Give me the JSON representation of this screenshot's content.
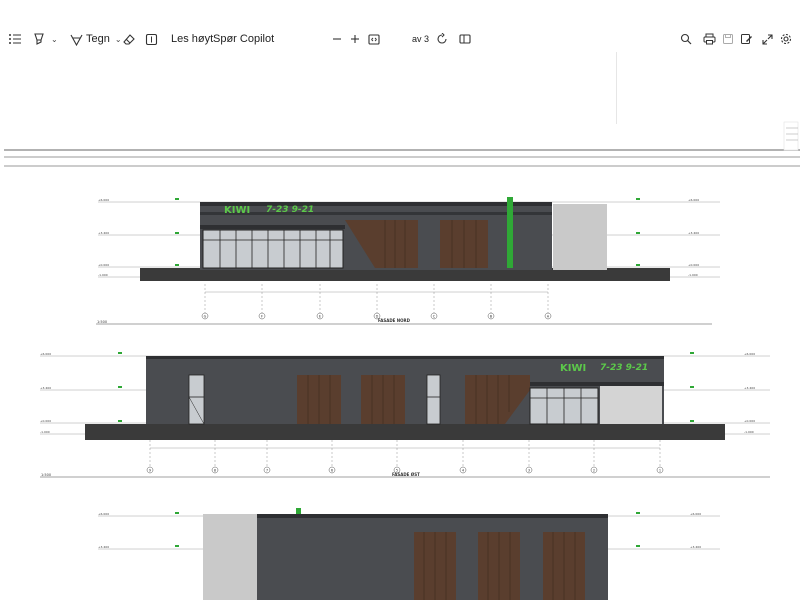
{
  "toolbar": {
    "draw_label": "Tegn",
    "read_aloud_label": "Les høyt",
    "copilot_label": "Spør Copilot",
    "page_of": "av 3",
    "icons": [
      "contents-icon",
      "highlight-icon",
      "draw-icon",
      "eraser-icon",
      "text-box-icon",
      "zoom-out-icon",
      "zoom-in-icon",
      "fit-page-icon",
      "rotate-icon",
      "page-view-icon",
      "search-icon",
      "print-icon",
      "save-icon",
      "save-as-icon",
      "fullscreen-icon",
      "settings-icon"
    ]
  },
  "drawing": {
    "facade1_title": "FASADE NORD",
    "facade2_title": "FASADE ØST",
    "scale": "1:500",
    "sign_logo": "KIWI",
    "sign_hours": "7-23 9-21",
    "grid_nord": [
      "G",
      "F",
      "E",
      "D",
      "C",
      "B",
      "A"
    ],
    "grid_ost": [
      "9",
      "8",
      "7",
      "6",
      "5",
      "4",
      "3",
      "2",
      "1"
    ],
    "level_labels": [
      "+6.000",
      "+3.400",
      "+0.000",
      "-1.000"
    ]
  },
  "colors": {
    "facade": "#4a4c50",
    "wood": "#5a3e2e",
    "green": "#2fa836",
    "ground": "#3a3a3a"
  }
}
